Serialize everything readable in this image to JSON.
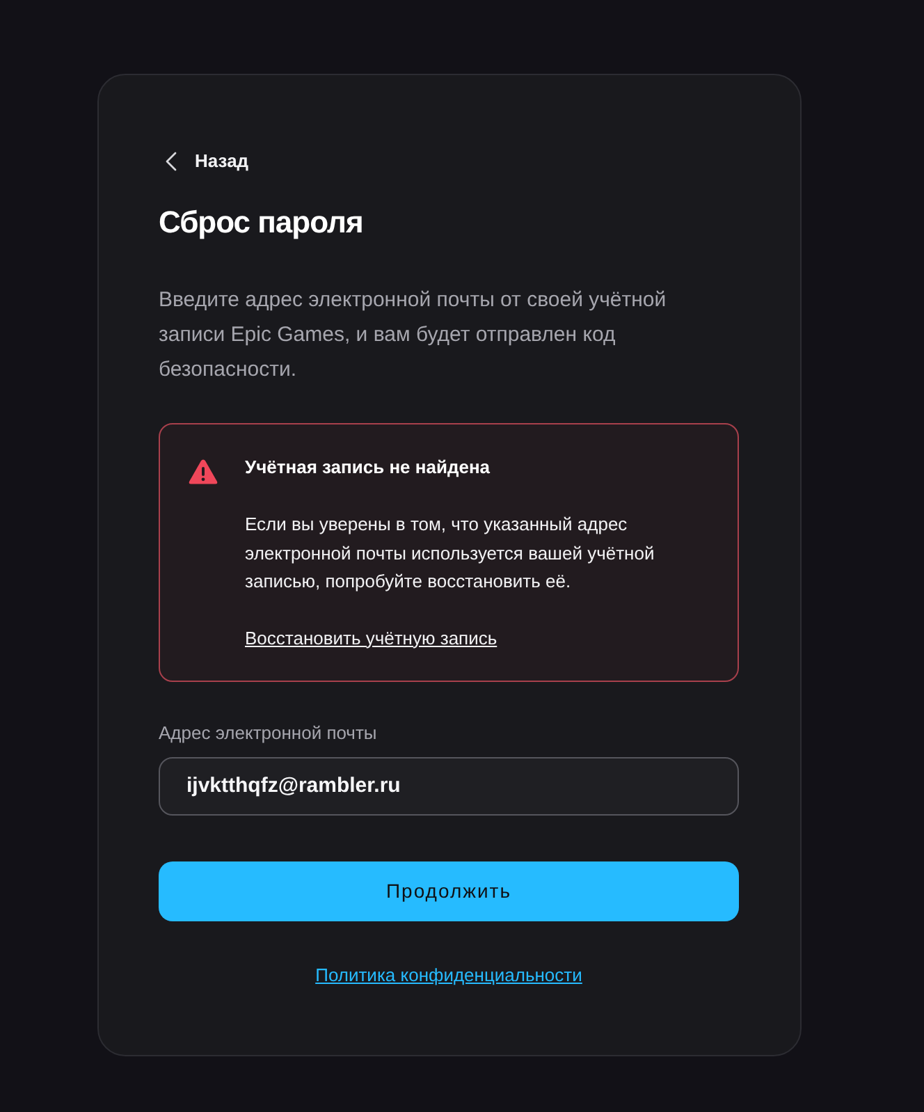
{
  "back_link": {
    "label": "Назад"
  },
  "title": "Сброс пароля",
  "description": "Введите адрес электронной почты от своей учётной записи Epic Games, и вам будет отправлен код безопасности.",
  "alert": {
    "kind": "error",
    "title": "Учётная запись не найдена",
    "message": "Если вы уверены в том, что указанный адрес электронной почты используется вашей учётной записью, попробуйте восстановить её.",
    "link": "Восстановить учётную запись"
  },
  "email_field": {
    "label": "Адрес электронной почты",
    "value": "ijvktthqfz@rambler.ru"
  },
  "submit_button": {
    "label": "Продолжить"
  },
  "footer_link": {
    "label": "Политика конфиденциальности"
  }
}
